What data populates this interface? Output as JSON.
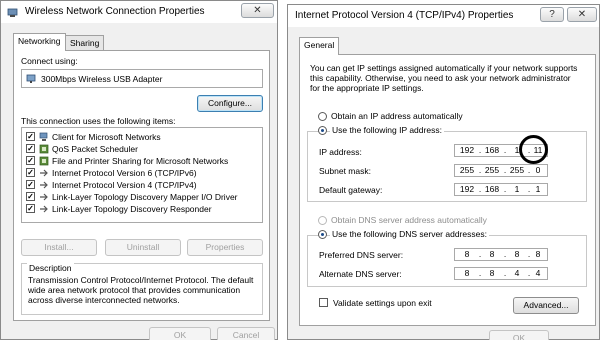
{
  "left_dialog": {
    "title": "Wireless Network Connection Properties",
    "tabs": [
      "Networking",
      "Sharing"
    ],
    "connect_using_label": "Connect using:",
    "adapter_name": "300Mbps Wireless USB Adapter",
    "configure_label": "Configure...",
    "items_label": "This connection uses the following items:",
    "items": [
      {
        "label": "Client for Microsoft Networks",
        "checked": true,
        "icon": "network-client-icon"
      },
      {
        "label": "QoS Packet Scheduler",
        "checked": true,
        "icon": "qos-scheduler-icon"
      },
      {
        "label": "File and Printer Sharing for Microsoft Networks",
        "checked": true,
        "icon": "file-printer-sharing-icon"
      },
      {
        "label": "Internet Protocol Version 6 (TCP/IPv6)",
        "checked": true,
        "icon": "protocol-icon"
      },
      {
        "label": "Internet Protocol Version 4 (TCP/IPv4)",
        "checked": true,
        "icon": "protocol-icon"
      },
      {
        "label": "Link-Layer Topology Discovery Mapper I/O Driver",
        "checked": true,
        "icon": "protocol-icon"
      },
      {
        "label": "Link-Layer Topology Discovery Responder",
        "checked": true,
        "icon": "protocol-icon"
      }
    ],
    "install_label": "Install...",
    "uninstall_label": "Uninstall",
    "properties_label": "Properties",
    "description_title": "Description",
    "description_text": [
      "Transmission Control Protocol/Internet Protocol. The default",
      "wide area network protocol that provides communication",
      "across diverse interconnected networks."
    ],
    "ok_label": "OK",
    "cancel_label": "Cancel"
  },
  "right_dialog": {
    "title": "Internet Protocol Version 4 (TCP/IPv4) Properties",
    "help_glyph": "?",
    "close_glyph": "✕",
    "tab": "General",
    "intro": [
      "You can get IP settings assigned automatically if your network supports",
      "this capability. Otherwise, you need to ask your network administrator",
      "for the appropriate IP settings."
    ],
    "obtain_ip_auto": "Obtain an IP address automatically",
    "use_following_ip": "Use the following IP address:",
    "ip_address_label": "IP address:",
    "ip_address": [
      "192",
      "168",
      "1",
      "11"
    ],
    "subnet_label": "Subnet mask:",
    "subnet": [
      "255",
      "255",
      "255",
      "0"
    ],
    "gateway_label": "Default gateway:",
    "gateway": [
      "192",
      "168",
      "1",
      "1"
    ],
    "obtain_dns_auto": "Obtain DNS server address automatically",
    "use_following_dns": "Use the following DNS server addresses:",
    "preferred_dns_label": "Preferred DNS server:",
    "preferred_dns": [
      "8",
      "8",
      "8",
      "8"
    ],
    "alternate_dns_label": "Alternate DNS server:",
    "alternate_dns": [
      "8",
      "8",
      "4",
      "4"
    ],
    "validate_label": "Validate settings upon exit",
    "advanced_label": "Advanced...",
    "ok_label": "OK"
  },
  "left_close_glyph": "✕"
}
